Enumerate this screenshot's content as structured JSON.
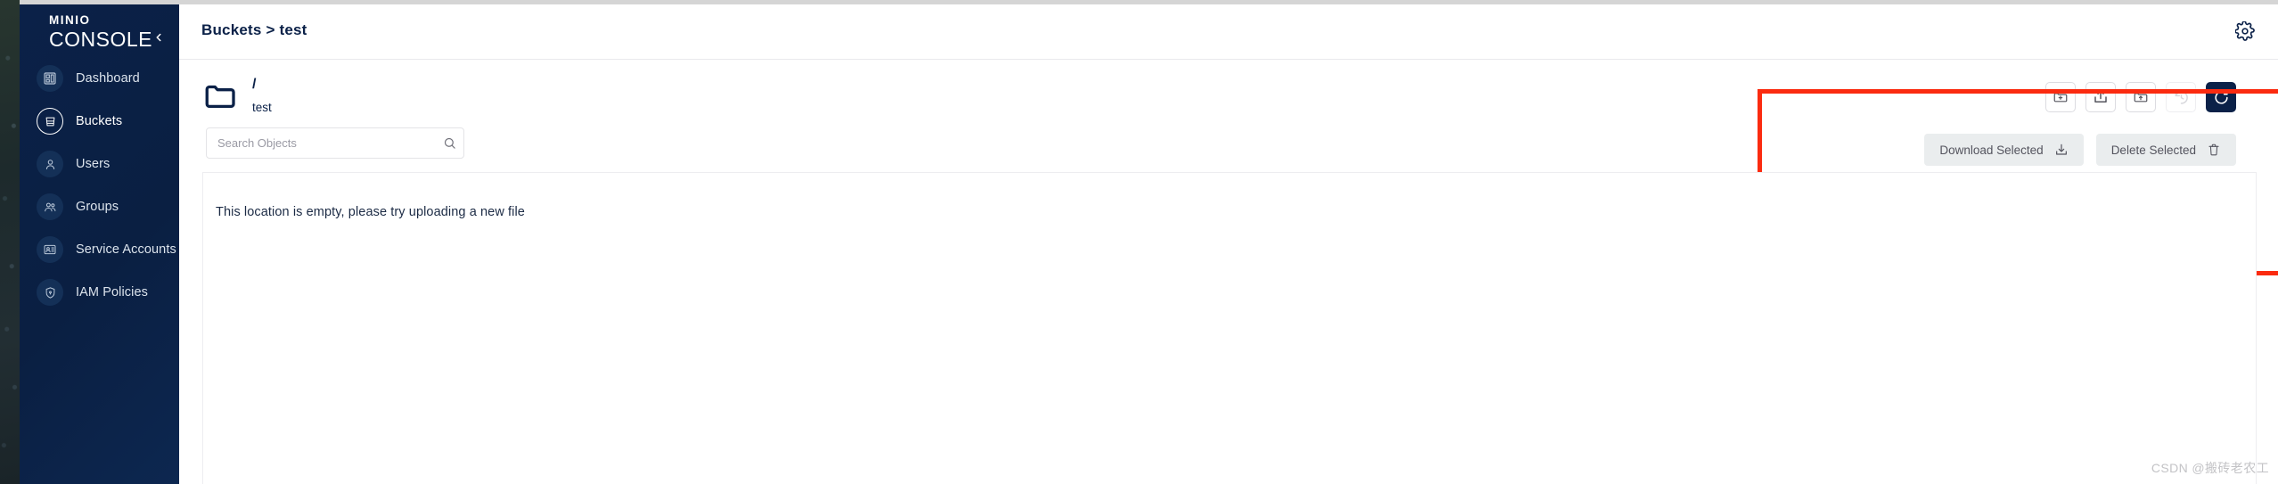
{
  "app": {
    "brand_primary": "MINIO",
    "brand_secondary": "CONSOLE",
    "accent_navy": "#0b2148",
    "highlight_red": "#fb2b10"
  },
  "sidebar": {
    "collapse_icon": "chevron-left-icon",
    "items": [
      {
        "label": "Dashboard",
        "icon": "dashboard-icon",
        "active": false
      },
      {
        "label": "Buckets",
        "icon": "bucket-icon",
        "active": true
      },
      {
        "label": "Users",
        "icon": "user-icon",
        "active": false
      },
      {
        "label": "Groups",
        "icon": "groups-icon",
        "active": false
      },
      {
        "label": "Service Accounts",
        "icon": "service-account-icon",
        "active": false
      },
      {
        "label": "IAM Policies",
        "icon": "shield-icon",
        "active": false
      }
    ]
  },
  "header": {
    "breadcrumb": "Buckets > test",
    "settings_icon": "gear-icon"
  },
  "object_browser": {
    "folder_icon": "folder-icon",
    "path_root": "/",
    "bucket_name": "test",
    "search": {
      "value": "",
      "placeholder": "Search Objects",
      "icon": "search-icon"
    }
  },
  "toolbar": {
    "icon_buttons": [
      {
        "name": "create-new-path-button",
        "icon": "folder-plus-icon",
        "disabled": false,
        "primary": false
      },
      {
        "name": "upload-file-button",
        "icon": "upload-icon",
        "disabled": false,
        "primary": false
      },
      {
        "name": "upload-folder-button",
        "icon": "folder-upload-icon",
        "disabled": false,
        "primary": false
      },
      {
        "name": "rewind-button",
        "icon": "rewind-clock-icon",
        "disabled": true,
        "primary": false
      },
      {
        "name": "refresh-button",
        "icon": "refresh-icon",
        "disabled": false,
        "primary": true
      }
    ],
    "download_selected_label": "Download Selected",
    "download_selected_icon": "download-icon",
    "delete_selected_label": "Delete Selected",
    "delete_selected_icon": "trash-icon"
  },
  "main": {
    "empty_message": "This location is empty, please try uploading a new file"
  },
  "watermark": "CSDN @搬砖老农工"
}
